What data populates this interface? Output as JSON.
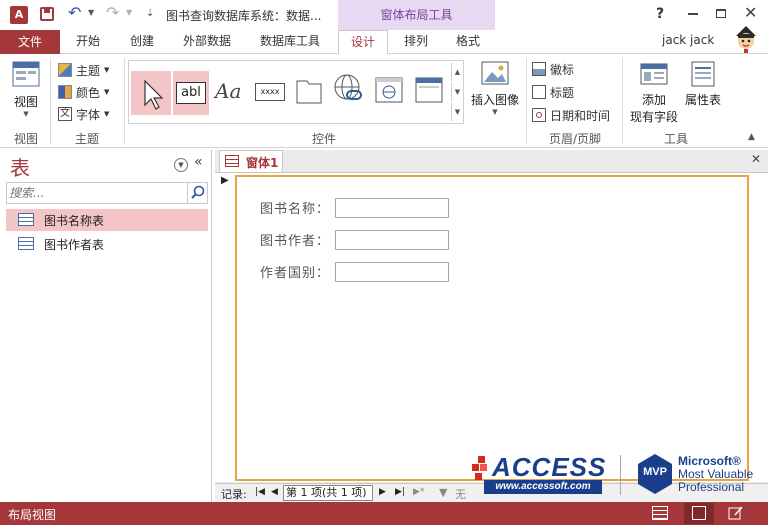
{
  "titlebar": {
    "app_icon": "A",
    "title": "图书查询数据库系统：数据...",
    "context_tab_title": "窗体布局工具",
    "help": "?"
  },
  "tabs": {
    "file": "文件",
    "items": [
      "开始",
      "创建",
      "外部数据",
      "数据库工具",
      "设计",
      "排列",
      "格式"
    ],
    "active": "设计",
    "user": "jack jack"
  },
  "ribbon": {
    "view_label": "视图",
    "view_group": "视图",
    "theme_items": [
      "主题",
      "颜色",
      "字体"
    ],
    "theme_group": "主题",
    "controls_group": "控件",
    "textbox_label": "abl",
    "label_control": "Aa",
    "button_control": "xxxx",
    "insert_image": "插入图像",
    "header_items": [
      "徽标",
      "标题",
      "日期和时间"
    ],
    "header_group": "页眉/页脚",
    "add_fields_line1": "添加",
    "add_fields_line2": "现有字段",
    "property_sheet": "属性表",
    "tools_group": "工具"
  },
  "nav": {
    "title": "表",
    "search_placeholder": "搜索...",
    "items": [
      "图书名称表",
      "图书作者表"
    ]
  },
  "doc": {
    "tab_label": "窗体1",
    "fields": [
      "图书名称：",
      "图书作者：",
      "作者国别："
    ],
    "record_label": "记录:",
    "record_value": "第 1 项(共 1 项)",
    "filter_label": "无"
  },
  "watermark": {
    "access_text": "ACCESS",
    "access_url": "www.accessoft.com",
    "mvp": "MVP",
    "ms_line1": "Microsoft®",
    "ms_line2": "Most Valuable",
    "ms_line3": "Professional"
  },
  "status": {
    "text": "布局视图"
  },
  "colors": {
    "brand": "#a4373a",
    "context": "#7b3f9e",
    "selected": "#f4c5c6",
    "form_border": "#e8a33d"
  }
}
